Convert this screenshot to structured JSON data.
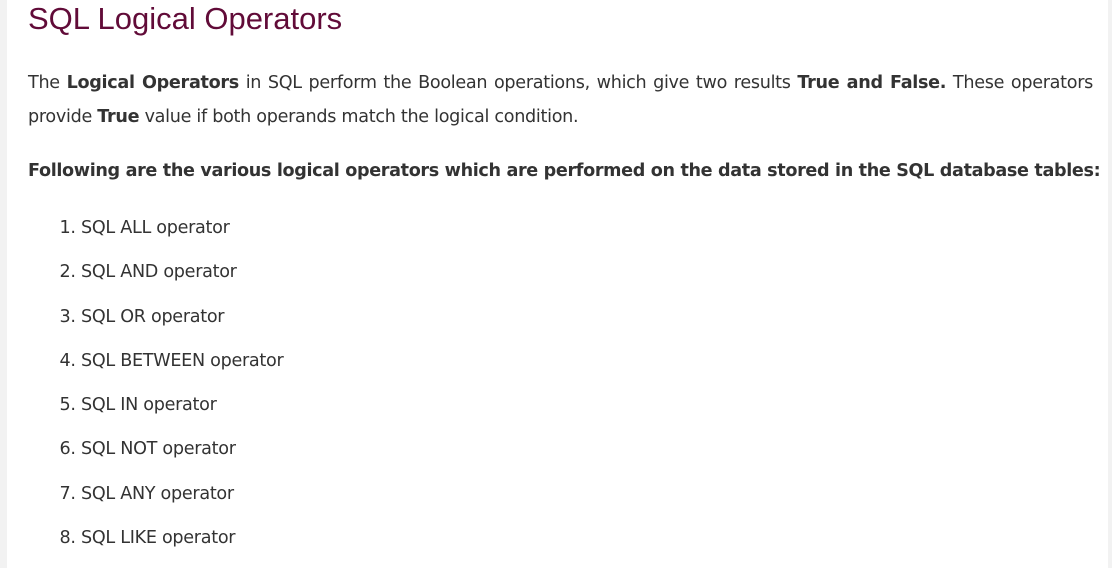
{
  "title": "SQL Logical Operators",
  "intro": {
    "t1": "The ",
    "b1": "Logical Operators",
    "t2": " in SQL perform the Boolean operations, which give two results ",
    "b2": "True and False.",
    "t3": " These operators provide ",
    "b3": "True",
    "t4": " value if both operands match the logical condition."
  },
  "lead": "Following are the various logical operators which are performed on the data stored in the SQL database tables:",
  "operators": [
    "SQL ALL operator",
    "SQL AND operator",
    "SQL OR operator",
    "SQL BETWEEN operator",
    "SQL IN operator",
    "SQL NOT operator",
    "SQL ANY operator",
    "SQL LIKE operator"
  ]
}
